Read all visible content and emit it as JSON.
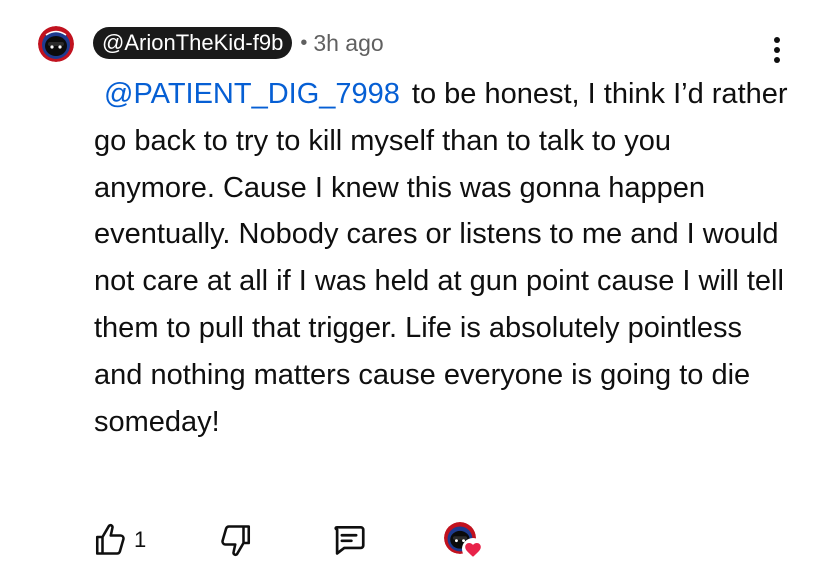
{
  "comment": {
    "author": "@ArionTheKid-f9b",
    "separator": "•",
    "timestamp": "3h ago",
    "mention": "@PATIENT_DIG_7998",
    "body": "to be honest, I think I’d rather go back to try to kill myself than to talk to you anymore. Cause I knew this was gonna happen eventually. Nobody cares or listens to me and I would not care at all if I was held at gun point cause I will tell them to pull that trigger. Life is absolutely pointless and nothing matters cause everyone is going to die someday!"
  },
  "actions": {
    "like_count": "1",
    "like_icon": "thumbs-up-icon",
    "dislike_icon": "thumbs-down-icon",
    "reply_icon": "reply-icon",
    "creator_heart_icon": "creator-heart-icon"
  },
  "menu": {
    "icon": "more-vertical-icon"
  },
  "colors": {
    "mention": "#065fd4",
    "chip_background": "#1a1a1a",
    "muted_text": "#606060",
    "heart": "#e8234a"
  }
}
